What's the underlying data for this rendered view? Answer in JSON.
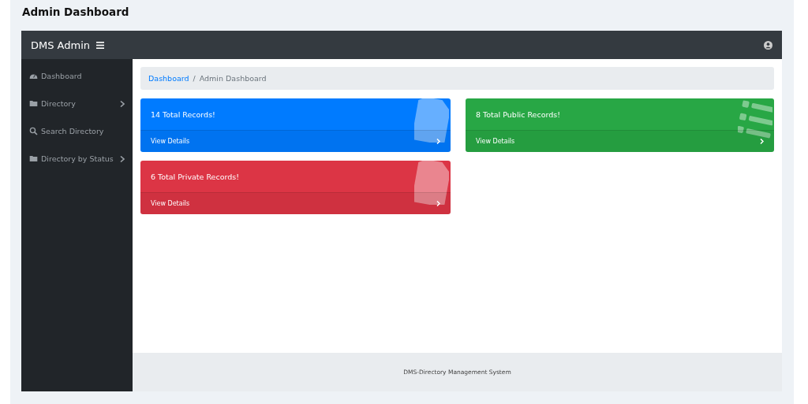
{
  "page_title": "Admin Dashboard",
  "topbar": {
    "brand": "DMS Admin"
  },
  "sidebar": {
    "items": [
      {
        "label": "Dashboard",
        "kind": "gauge",
        "submenu": false
      },
      {
        "label": "Directory",
        "kind": "folder",
        "submenu": true
      },
      {
        "label": "Search Directory",
        "kind": "search",
        "submenu": false
      },
      {
        "label": "Directory by Status",
        "kind": "folder",
        "submenu": true
      }
    ]
  },
  "breadcrumb": {
    "link": "Dashboard",
    "separator": "/",
    "current": "Admin Dashboard"
  },
  "cards": [
    {
      "title": "14 Total Records!",
      "link": "View Details",
      "color": "#007bff",
      "kind": "file"
    },
    {
      "title": "8 Total Public Records!",
      "link": "View Details",
      "color": "#28a745",
      "kind": "list"
    },
    {
      "title": "6 Total Private Records!",
      "link": "View Details",
      "color": "#dc3545",
      "kind": "file"
    }
  ],
  "footer": "DMS-Directory Management System"
}
